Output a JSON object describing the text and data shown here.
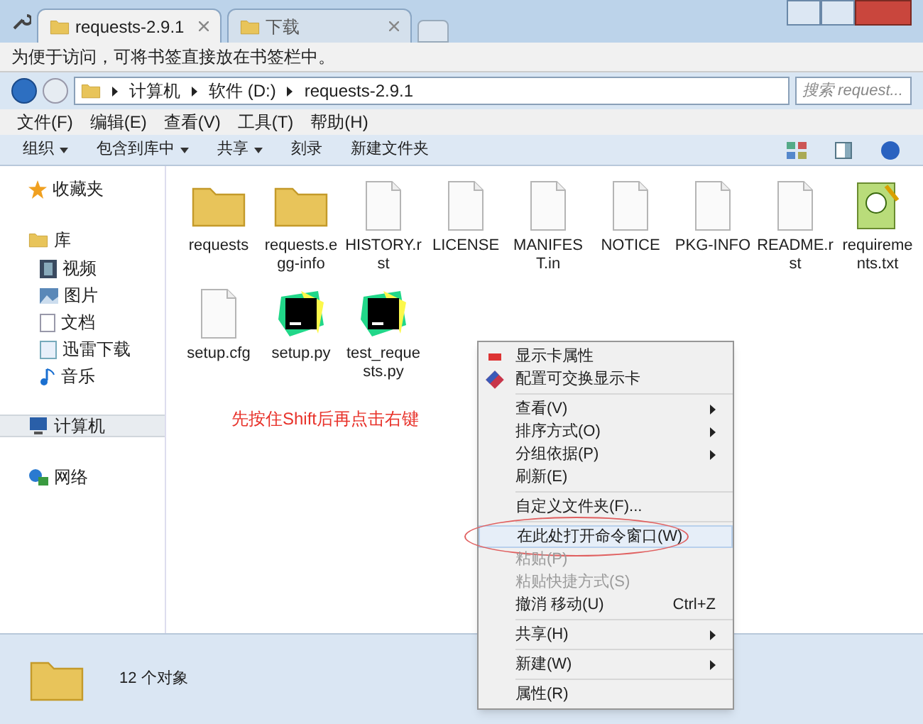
{
  "tabs": [
    {
      "label": "requests-2.9.1",
      "selected": true
    },
    {
      "label": "下载",
      "selected": false
    }
  ],
  "bookmark_bar": {
    "text": "为便于访问，可将书签直接放在书签栏中。"
  },
  "address": {
    "crumbs": [
      "计算机",
      "软件 (D:)",
      "requests-2.9.1"
    ],
    "search_placeholder": "搜索 request..."
  },
  "menu_bar": [
    "文件(F)",
    "编辑(E)",
    "查看(V)",
    "工具(T)",
    "帮助(H)"
  ],
  "command_bar": [
    {
      "label": "组织",
      "dropdown": true
    },
    {
      "label": "包含到库中",
      "dropdown": true
    },
    {
      "label": "共享",
      "dropdown": true
    },
    {
      "label": "刻录",
      "dropdown": false
    },
    {
      "label": "新建文件夹",
      "dropdown": false
    }
  ],
  "sidebar": [
    {
      "label": "收藏夹",
      "kind": "star",
      "selected": false
    },
    {
      "label": "库",
      "kind": "library",
      "selected": false,
      "children": [
        {
          "label": "视频",
          "kind": "video"
        },
        {
          "label": "图片",
          "kind": "picture"
        },
        {
          "label": "文档",
          "kind": "document"
        },
        {
          "label": "迅雷下载",
          "kind": "download"
        },
        {
          "label": "音乐",
          "kind": "music"
        }
      ]
    },
    {
      "label": "计算机",
      "kind": "computer",
      "selected": true
    },
    {
      "label": "网络",
      "kind": "network",
      "selected": false
    }
  ],
  "files": [
    {
      "name": "requests",
      "kind": "folder"
    },
    {
      "name": "requests.egg-info",
      "kind": "folder"
    },
    {
      "name": "HISTORY.rst",
      "kind": "file"
    },
    {
      "name": "LICENSE",
      "kind": "file"
    },
    {
      "name": "MANIFEST.in",
      "kind": "file"
    },
    {
      "name": "NOTICE",
      "kind": "file"
    },
    {
      "name": "PKG-INFO",
      "kind": "file"
    },
    {
      "name": "README.rst",
      "kind": "file"
    },
    {
      "name": "requirements.txt",
      "kind": "text"
    },
    {
      "name": "setup.cfg",
      "kind": "file"
    },
    {
      "name": "setup.py",
      "kind": "pycharm"
    },
    {
      "name": "test_requests.py",
      "kind": "pycharm"
    }
  ],
  "annotation": "先按住Shift后再点击右键",
  "context_menu": [
    [
      {
        "label": "显示卡属性",
        "submenu": false,
        "disabled": false,
        "selected": false
      },
      {
        "label": "配置可交换显示卡",
        "submenu": false,
        "disabled": false,
        "selected": false
      }
    ],
    [
      {
        "label": "查看(V)",
        "submenu": true,
        "disabled": false,
        "selected": false
      },
      {
        "label": "排序方式(O)",
        "submenu": true,
        "disabled": false,
        "selected": false
      },
      {
        "label": "分组依据(P)",
        "submenu": true,
        "disabled": false,
        "selected": false
      },
      {
        "label": "刷新(E)",
        "submenu": false,
        "disabled": false,
        "selected": false
      }
    ],
    [
      {
        "label": "自定义文件夹(F)...",
        "submenu": false,
        "disabled": false,
        "selected": false
      }
    ],
    [
      {
        "label": "在此处打开命令窗口(W)",
        "submenu": false,
        "disabled": false,
        "selected": true
      },
      {
        "label": "粘贴(P)",
        "submenu": false,
        "disabled": true,
        "selected": false
      },
      {
        "label": "粘贴快捷方式(S)",
        "submenu": false,
        "disabled": true,
        "selected": false
      },
      {
        "label": "撤消 移动(U)",
        "shortcut": "Ctrl+Z",
        "submenu": false,
        "disabled": false,
        "selected": false
      }
    ],
    [
      {
        "label": "共享(H)",
        "submenu": true,
        "disabled": false,
        "selected": false
      }
    ],
    [
      {
        "label": "新建(W)",
        "submenu": true,
        "disabled": false,
        "selected": false
      }
    ],
    [
      {
        "label": "属性(R)",
        "submenu": false,
        "disabled": false,
        "selected": false
      }
    ]
  ],
  "status_bar": {
    "text": "12 个对象"
  }
}
